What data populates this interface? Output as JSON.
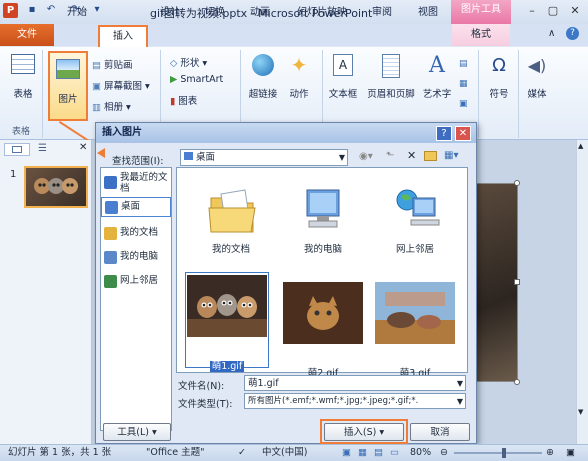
{
  "window": {
    "title": "gif图转为视频.pptx - Microsoft PowerPoint",
    "context_tool": "图片工具",
    "quick_access": [
      "save-icon",
      "undo-icon",
      "redo-icon",
      "customize-icon"
    ],
    "controls": [
      "–",
      "▢",
      "✕"
    ]
  },
  "tabs": [
    {
      "label": "文件"
    },
    {
      "label": "开始"
    },
    {
      "label": "插入"
    },
    {
      "label": "设计"
    },
    {
      "label": "切换"
    },
    {
      "label": "动画"
    },
    {
      "label": "幻灯片放映"
    },
    {
      "label": "审阅"
    },
    {
      "label": "视图"
    },
    {
      "label": "格式"
    }
  ],
  "ribbon": {
    "table": "表格",
    "picture": "图片",
    "clipart": "剪贴画",
    "screenshot": "屏幕截图",
    "album": "相册",
    "shapes": "形状",
    "smartart": "SmartArt",
    "chart": "图表",
    "hyperlink": "超链接",
    "action": "动作",
    "textbox": "文本框",
    "header_footer": "页眉和页脚",
    "wordart": "艺术字",
    "symbol": "符号",
    "media": "媒体",
    "group_table": "表格"
  },
  "slide_pane": {
    "slide_number": "1"
  },
  "dialog": {
    "title": "插入图片",
    "look_in_label": "查找范围(I):",
    "look_in_value": "桌面",
    "places": [
      {
        "label": "我最近的文档",
        "color": "#3b72c6"
      },
      {
        "label": "桌面",
        "color": "#4a7ed0"
      },
      {
        "label": "我的文档",
        "color": "#e3b33e"
      },
      {
        "label": "我的电脑",
        "color": "#5b88c9"
      },
      {
        "label": "网上邻居",
        "color": "#3d8c4a"
      }
    ],
    "files": [
      {
        "name": "我的文档",
        "icon": "folder-documents-icon"
      },
      {
        "name": "我的电脑",
        "icon": "computer-icon"
      },
      {
        "name": "网上邻居",
        "icon": "network-icon"
      },
      {
        "name": "萌1.gif",
        "icon": "image-thumbnail",
        "selected": true
      },
      {
        "name": "萌2.gif",
        "icon": "image-thumbnail"
      },
      {
        "name": "萌3.gif",
        "icon": "image-thumbnail"
      }
    ],
    "filename_label": "文件名(N):",
    "filename_value": "萌1.gif",
    "filetype_label": "文件类型(T):",
    "filetype_value": "所有图片(*.emf;*.wmf;*.jpg;*.jpeg;*.gif;*.",
    "tools": "工具(L)",
    "insert": "插入(S)",
    "cancel": "取消"
  },
  "status": {
    "slide": "幻灯片 第 1 张，共 1 张",
    "theme": "\"Office 主题\"",
    "language": "中文(中国)",
    "zoom": "80%"
  },
  "colors": {
    "accent": "#ef7d38",
    "file_tab": "#d65c22",
    "context": "#e978a6"
  }
}
